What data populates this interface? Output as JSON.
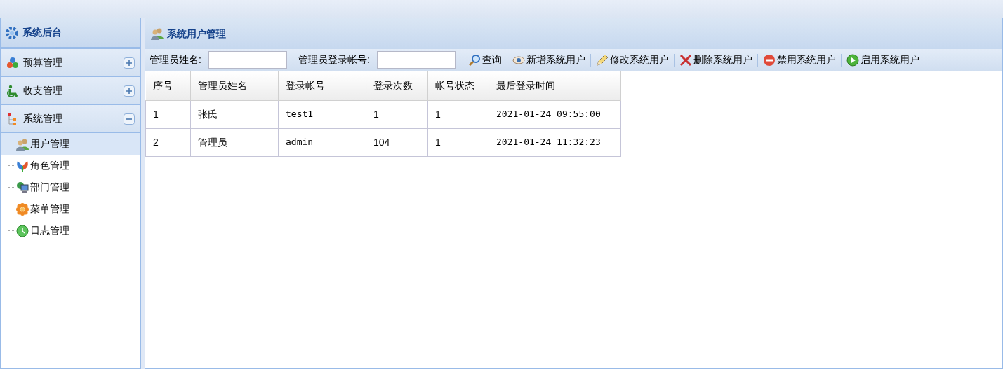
{
  "sidebar": {
    "title": "系统后台",
    "groups": [
      {
        "label": "预算管理",
        "expanded": false
      },
      {
        "label": "收支管理",
        "expanded": false
      },
      {
        "label": "系统管理",
        "expanded": true,
        "children": [
          {
            "label": "用户管理",
            "selected": true
          },
          {
            "label": "角色管理",
            "selected": false
          },
          {
            "label": "部门管理",
            "selected": false
          },
          {
            "label": "菜单管理",
            "selected": false
          },
          {
            "label": "日志管理",
            "selected": false
          }
        ]
      }
    ]
  },
  "panel": {
    "title": "系统用户管理"
  },
  "filters": [
    {
      "label": "管理员姓名:"
    },
    {
      "label": "管理员登录帐号:"
    }
  ],
  "toolbar": [
    "查询",
    "新增系统用户",
    "修改系统用户",
    "删除系统用户",
    "禁用系统用户",
    "启用系统用户"
  ],
  "table": {
    "columns": [
      "序号",
      "管理员姓名",
      "登录帐号",
      "登录次数",
      "帐号状态",
      "最后登录时间"
    ],
    "rows": [
      [
        "1",
        "张氏",
        "test1",
        "1",
        "1",
        "2021-01-24 09:55:00"
      ],
      [
        "2",
        "管理员",
        "admin",
        "104",
        "1",
        "2021-01-24 11:32:23"
      ]
    ]
  }
}
